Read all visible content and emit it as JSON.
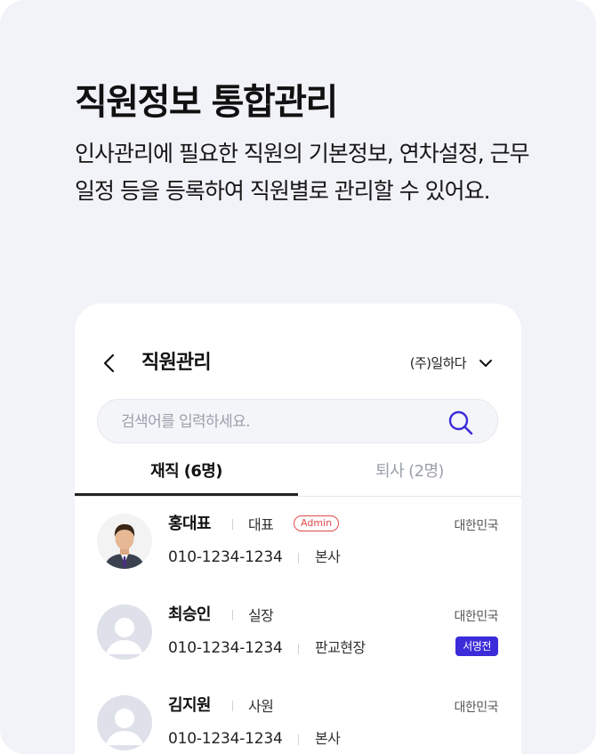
{
  "hero": {
    "title": "직원정보 통합관리",
    "description": "인사관리에 필요한 직원의 기본정보, 연차설정, 근무일정 등을 등록하여 직원별로 관리할 수 있어요."
  },
  "header": {
    "back_icon": "chevron-left-icon",
    "title": "직원관리",
    "company": "(주)일하다",
    "company_icon": "chevron-down-icon"
  },
  "search": {
    "placeholder": "검색어를 입력하세요.",
    "value": "",
    "icon": "search-icon"
  },
  "tabs": [
    {
      "label": "재직 (6명)",
      "active": true
    },
    {
      "label": "퇴사 (2명)",
      "active": false
    }
  ],
  "employees": [
    {
      "name": "홍대표",
      "role": "대표",
      "tag": "Admin",
      "country": "대한민국",
      "phone": "010-1234-1234",
      "site": "본사",
      "badge": ""
    },
    {
      "name": "최승인",
      "role": "실장",
      "tag": "",
      "country": "대한민국",
      "phone": "010-1234-1234",
      "site": "판교현장",
      "badge": "서명전"
    },
    {
      "name": "김지원",
      "role": "사원",
      "tag": "",
      "country": "대한민국",
      "phone": "010-1234-1234",
      "site": "본사",
      "badge": ""
    }
  ],
  "colors": {
    "background": "#f2f3f8",
    "accent": "#3b2bd9",
    "admin": "#e24a4a",
    "search_icon": "#3b2bd9"
  }
}
